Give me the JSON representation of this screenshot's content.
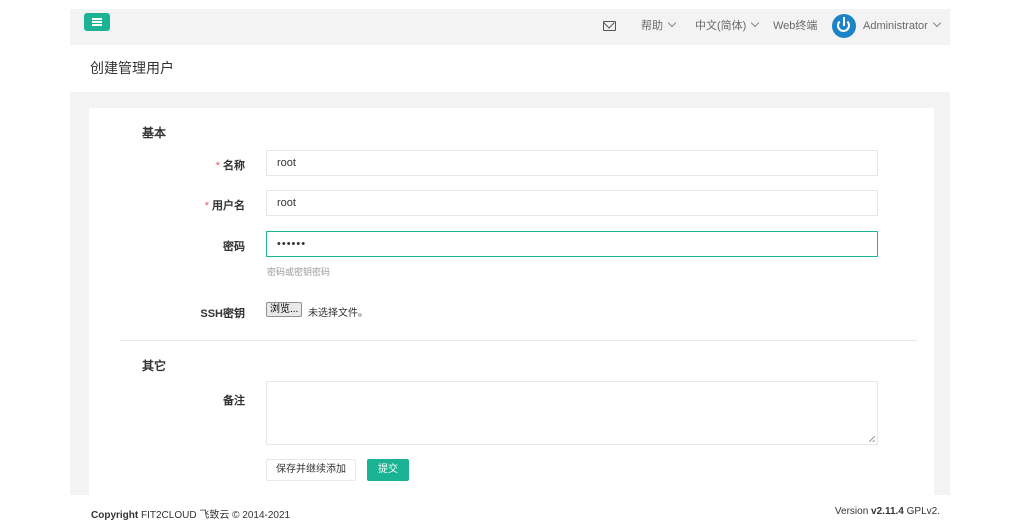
{
  "topbar": {
    "help": "帮助",
    "language": "中文(简体)",
    "web_terminal": "Web终端",
    "user": "Administrator",
    "icons": [
      "menu-icon",
      "mail-icon",
      "avatar-power-icon"
    ],
    "accent": "#1ab394",
    "avatar_color": "#1c84c6"
  },
  "page": {
    "title": "创建管理用户"
  },
  "form": {
    "section_basic": "基本",
    "name_required": "*",
    "name_label": "名称",
    "name_value": "root",
    "username_required": "*",
    "username_label": "用户名",
    "username_value": "root",
    "password_label": "密码",
    "password_value": "••••••",
    "password_hint": "密码或密钥密码",
    "ssh_label": "SSH密钥",
    "file_button": "浏览...",
    "file_status": "未选择文件。",
    "section_other": "其它",
    "comment_label": "备注",
    "comment_value": "",
    "save_continue": "保存并继续添加",
    "submit": "提交"
  },
  "footer": {
    "copyright_bold": "Copyright",
    "copyright_text": " FIT2CLOUD 飞致云 © 2014-2021",
    "version_prefix": "Version ",
    "version_number": "v2.11.4",
    "version_suffix": " GPLv2."
  }
}
